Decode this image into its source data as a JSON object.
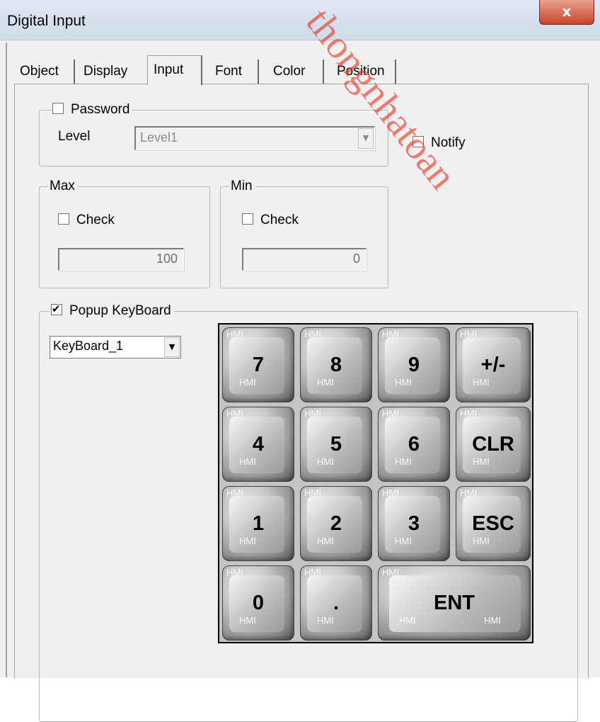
{
  "window": {
    "title": "Digital Input",
    "close_label": "x"
  },
  "tabs": [
    {
      "label": "Object",
      "active": false
    },
    {
      "label": "Display",
      "active": false
    },
    {
      "label": "Input",
      "active": true
    },
    {
      "label": "Font",
      "active": false
    },
    {
      "label": "Color",
      "active": false
    },
    {
      "label": "Position",
      "active": false
    }
  ],
  "password": {
    "legend": "Password",
    "checked": false,
    "level_label": "Level",
    "level_value": "Level1"
  },
  "notify": {
    "label": "Notify",
    "checked": false
  },
  "max": {
    "legend": "Max",
    "check_label": "Check",
    "checked": false,
    "value": "100"
  },
  "min": {
    "legend": "Min",
    "check_label": "Check",
    "checked": false,
    "value": "0"
  },
  "popup": {
    "legend": "Popup KeyBoard",
    "checked": true,
    "keyboard_value": "KeyBoard_1"
  },
  "keyboard": {
    "keys": [
      "7",
      "8",
      "9",
      "+/-",
      "4",
      "5",
      "6",
      "CLR",
      "1",
      "2",
      "3",
      "ESC",
      "0",
      ".",
      "ENT"
    ],
    "watermark_text": "HMI"
  },
  "watermark": {
    "text": "thongnhatoan"
  },
  "icons": {
    "close": "close-icon",
    "dropdown": "chevron-down-icon",
    "check": "checkmark-icon"
  },
  "colors": {
    "close_button": "#c7442a",
    "watermark": "#e63c28"
  }
}
